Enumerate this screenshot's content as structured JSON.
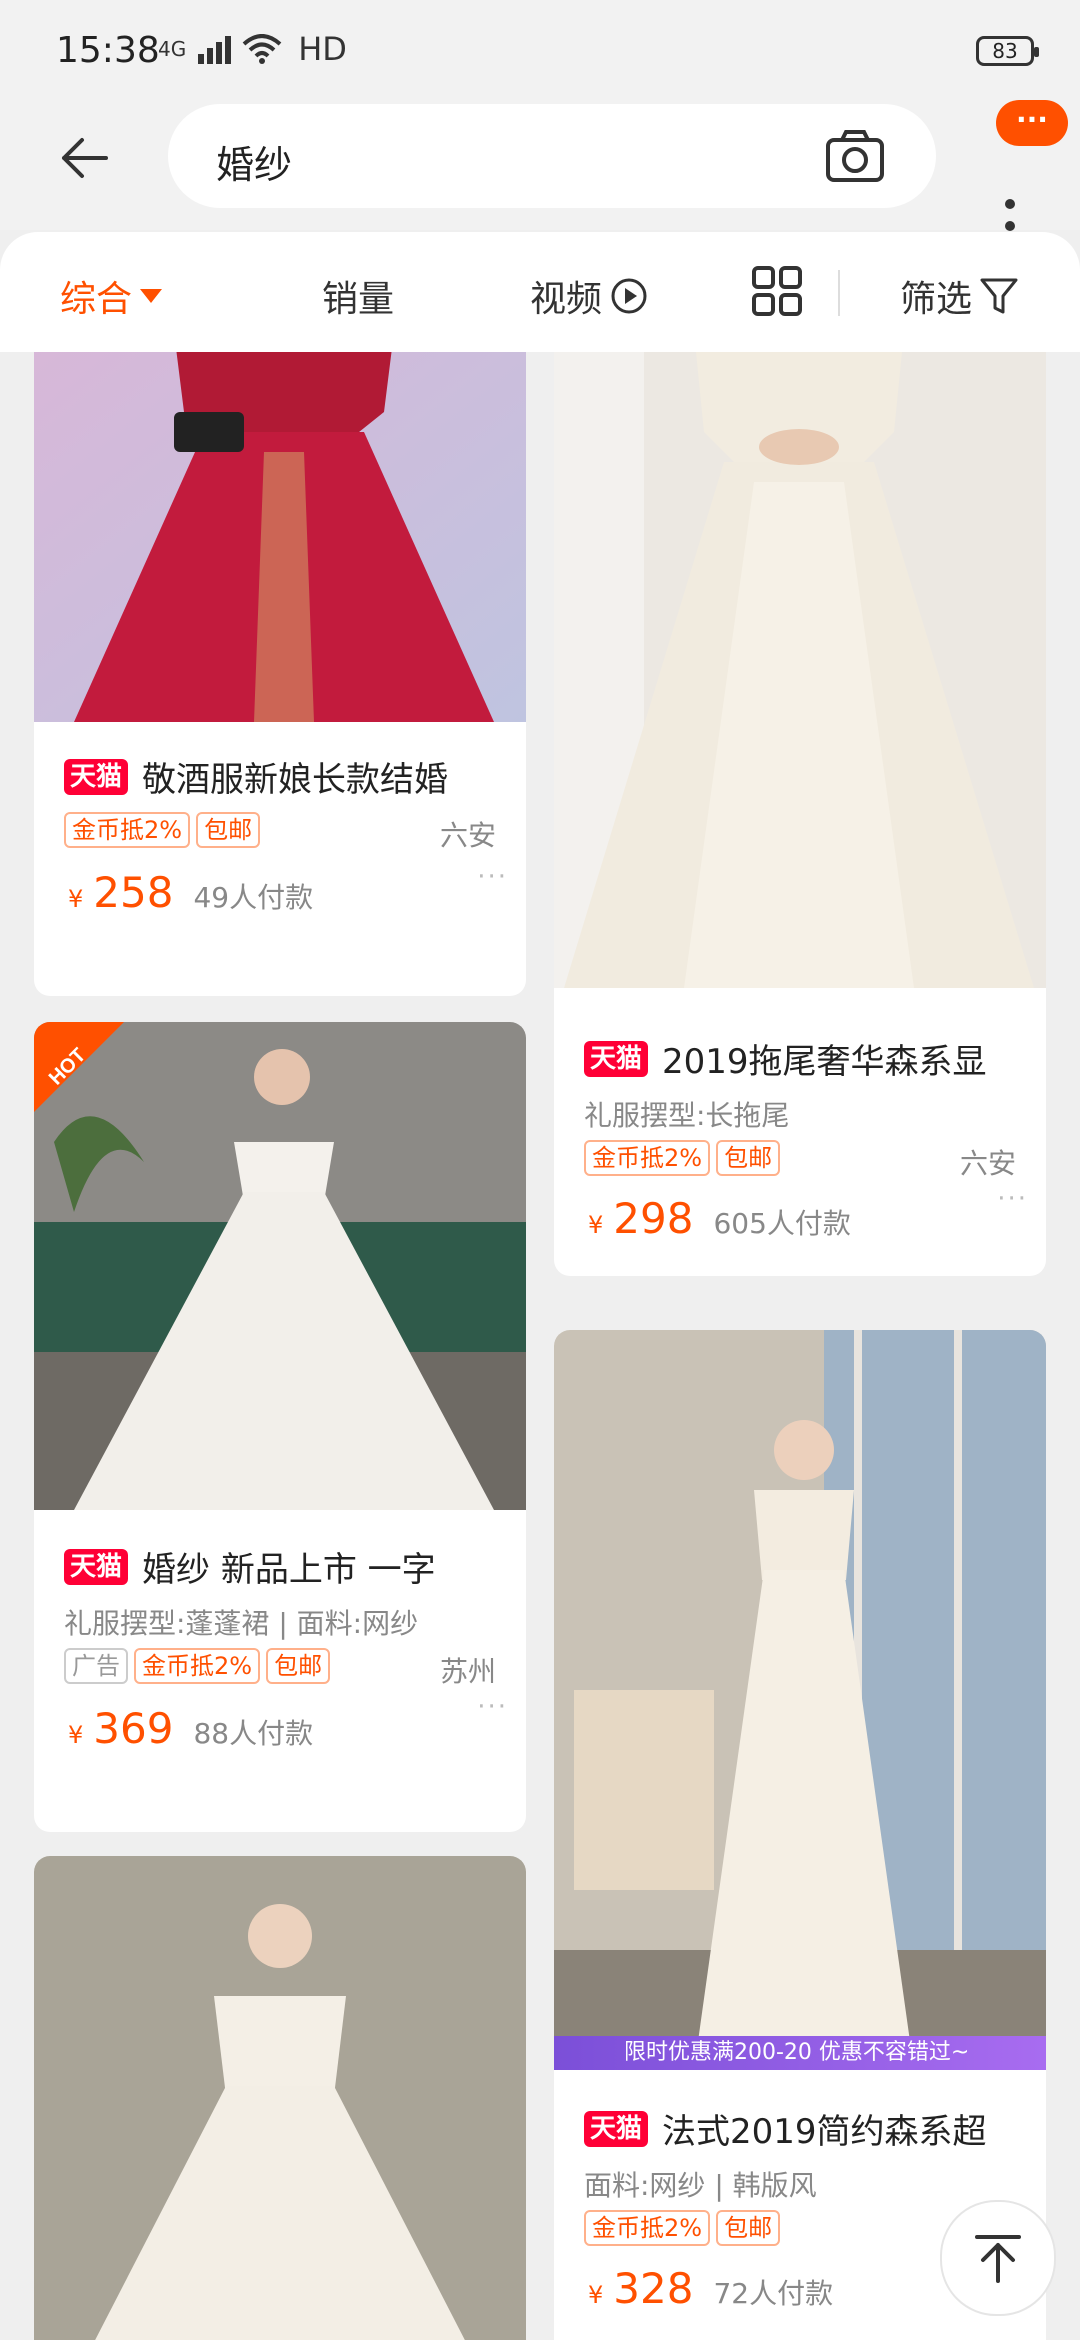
{
  "status": {
    "time": "15:38",
    "network": "4G",
    "hd": "HD",
    "battery": "83"
  },
  "search": {
    "query": "婚纱"
  },
  "more_badge": "···",
  "filters": [
    {
      "label": "综合"
    },
    {
      "label": "销量"
    },
    {
      "label": "视频"
    },
    {
      "label": "筛选"
    }
  ],
  "products": [
    {
      "badge": "天猫",
      "title": "敬酒服新娘长款结婚",
      "tags": [
        "金币抵2%",
        "包邮"
      ],
      "location": "六安",
      "yen": "¥",
      "price": "258",
      "sold": "49人付款"
    },
    {
      "badge": "天猫",
      "title": "2019拖尾奢华森系显",
      "attrs": "礼服摆型:长拖尾",
      "tags": [
        "金币抵2%",
        "包邮"
      ],
      "location": "六安",
      "yen": "¥",
      "price": "298",
      "sold": "605人付款"
    },
    {
      "hot": "HOT",
      "badge": "天猫",
      "title": "婚纱 新品上市 一字",
      "attrs": "礼服摆型:蓬蓬裙 | 面料:网纱",
      "tags": [
        "广告",
        "金币抵2%",
        "包邮"
      ],
      "location": "苏州",
      "yen": "¥",
      "price": "369",
      "sold": "88人付款"
    },
    {
      "promo": "限时优惠满200-20  优惠不容错过~",
      "badge": "天猫",
      "title": "法式2019简约森系超",
      "attrs": "面料:网纱 | 韩版风",
      "tags": [
        "金币抵2%",
        "包邮"
      ],
      "yen": "¥",
      "price": "328",
      "sold": "72人付款"
    }
  ]
}
